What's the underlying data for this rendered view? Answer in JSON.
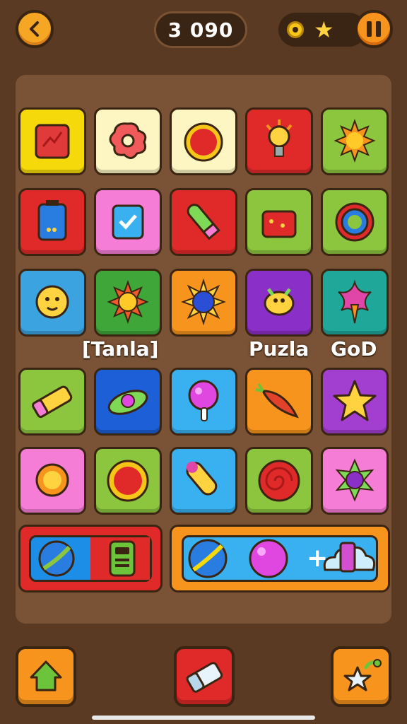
{
  "header": {
    "score": "3 090",
    "back_icon": "chevron-left-icon",
    "coin_icon": "coin-icon",
    "star_icon": "star-icon",
    "pause_icon": "pause-icon"
  },
  "board": {
    "overlay_labels": {
      "left": "[Tanla]",
      "middle": "Puzla",
      "right": "GoD"
    },
    "rows": [
      [
        {
          "icon": "red-notebook-icon",
          "bg": "#f5d90a"
        },
        {
          "icon": "red-flower-cookie-icon",
          "bg": "#fdf6c2"
        },
        {
          "icon": "red-ball-icon",
          "bg": "#fdf6c2"
        },
        {
          "icon": "lightbulb-icon",
          "bg": "#e02a2a"
        },
        {
          "icon": "orange-sun-icon",
          "bg": "#8cc63f"
        }
      ],
      [
        {
          "icon": "blue-battery-icon",
          "bg": "#e02a2a"
        },
        {
          "icon": "checkbox-clipboard-icon",
          "bg": "#f67dd6"
        },
        {
          "icon": "green-rocket-icon",
          "bg": "#e02a2a"
        },
        {
          "icon": "red-gift-box-icon",
          "bg": "#8cc63f"
        },
        {
          "icon": "blue-ring-icon",
          "bg": "#8cc63f"
        }
      ],
      [
        {
          "icon": "smiling-gear-icon",
          "bg": "#3aa3e0"
        },
        {
          "icon": "sun-flower-icon",
          "bg": "#3fa63a"
        },
        {
          "icon": "blue-orb-sun-icon",
          "bg": "#f7941d"
        },
        {
          "icon": "yellow-bird-icon",
          "bg": "#8b2fc9"
        },
        {
          "icon": "carrot-flower-icon",
          "bg": "#1fa79a"
        }
      ],
      [
        {
          "icon": "yellow-crayon-icon",
          "bg": "#8cc63f"
        },
        {
          "icon": "green-saucer-icon",
          "bg": "#1d5fd6"
        },
        {
          "icon": "pink-lollipop-icon",
          "bg": "#39b0f0"
        },
        {
          "icon": "red-carrot-icon",
          "bg": "#f7941d"
        },
        {
          "icon": "yellow-star-icon",
          "bg": "#a23fd1"
        }
      ],
      [
        {
          "icon": "orange-gear-icon",
          "bg": "#f67dd6"
        },
        {
          "icon": "red-heart-button-icon",
          "bg": "#8cc63f"
        },
        {
          "icon": "yellow-rocket-icon",
          "bg": "#39b0f0"
        },
        {
          "icon": "red-swirl-icon",
          "bg": "#8cc63f"
        },
        {
          "icon": "purple-flower-icon",
          "bg": "#f67dd6"
        }
      ]
    ]
  },
  "tray": {
    "left_items": [
      "blue-planet-icon",
      "green-phone-icon"
    ],
    "right_items": [
      "blue-planet-icon",
      "pink-orb-icon",
      "cloud-gift-icon"
    ],
    "plus_text": "+"
  },
  "footer": {
    "left_icon": "green-house-icon",
    "middle_icon": "eraser-icon",
    "right_icon": "star-magnet-icon",
    "left_color": "#f7941d",
    "middle_color": "#e02a2a",
    "right_color": "#f7941d"
  }
}
